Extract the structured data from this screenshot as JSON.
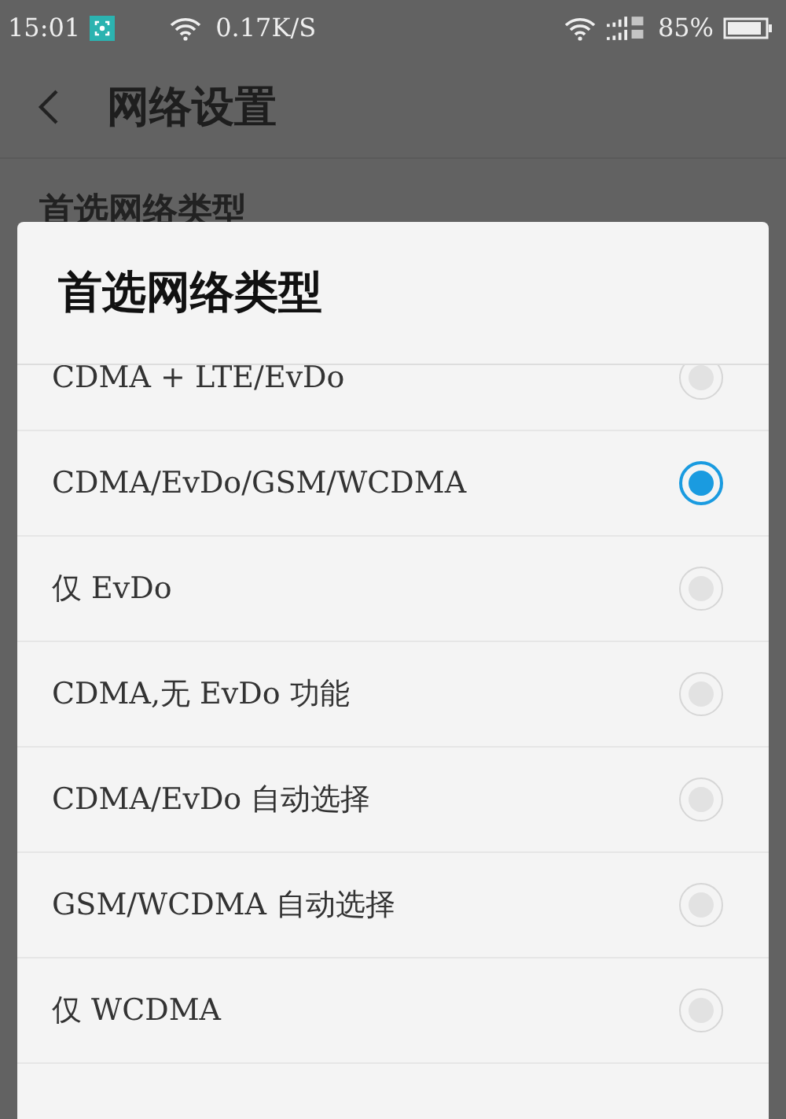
{
  "status_bar": {
    "time": "15:01",
    "speed": "0.17K/S",
    "battery": "85%"
  },
  "header": {
    "title": "网络设置"
  },
  "background_item": {
    "label": "首选网络类型"
  },
  "dialog": {
    "title": "首选网络类型",
    "options": [
      {
        "label": "CDMA + LTE/EvDo",
        "selected": false
      },
      {
        "label": "CDMA/EvDo/GSM/WCDMA",
        "selected": true
      },
      {
        "label": "仅 EvDo",
        "selected": false
      },
      {
        "label": "CDMA,无 EvDo 功能",
        "selected": false
      },
      {
        "label": "CDMA/EvDo 自动选择",
        "selected": false
      },
      {
        "label": "GSM/WCDMA 自动选择",
        "selected": false
      },
      {
        "label": "仅 WCDMA",
        "selected": false
      }
    ]
  }
}
